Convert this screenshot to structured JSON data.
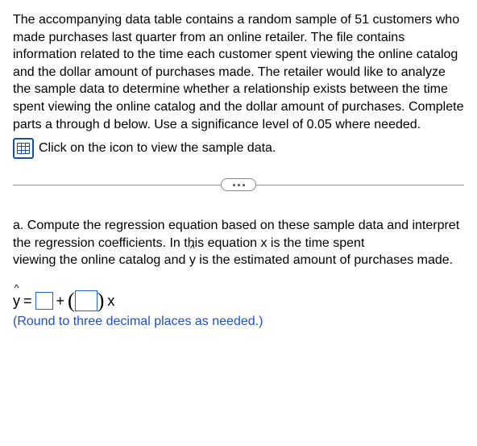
{
  "intro_text": "The accompanying data table contains a random sample of 51 customers who made purchases last quarter from an online retailer. The file contains information related to the time each customer spent viewing the online catalog and the dollar amount of purchases made. The retailer would like to analyze the sample data to determine whether a relationship exists between the time spent viewing the online catalog and the dollar amount of purchases. Complete parts a through d below. Use a significance level of 0.05 where needed.",
  "data_link_text": "Click on the icon to view the sample data.",
  "part_a": {
    "line1": "a. Compute the regression equation based on these sample data and interpret the regression coefficients. In this equation x is the time spent",
    "line2_pre": "viewing the online catalog and ",
    "line2_post": " is the estimated amount of purchases made."
  },
  "equation": {
    "y_hat": "y",
    "caret": "^",
    "equals": "=",
    "plus": "+",
    "x": "x",
    "intercept": "",
    "slope": ""
  },
  "note": "(Round to three decimal places as needed.)"
}
